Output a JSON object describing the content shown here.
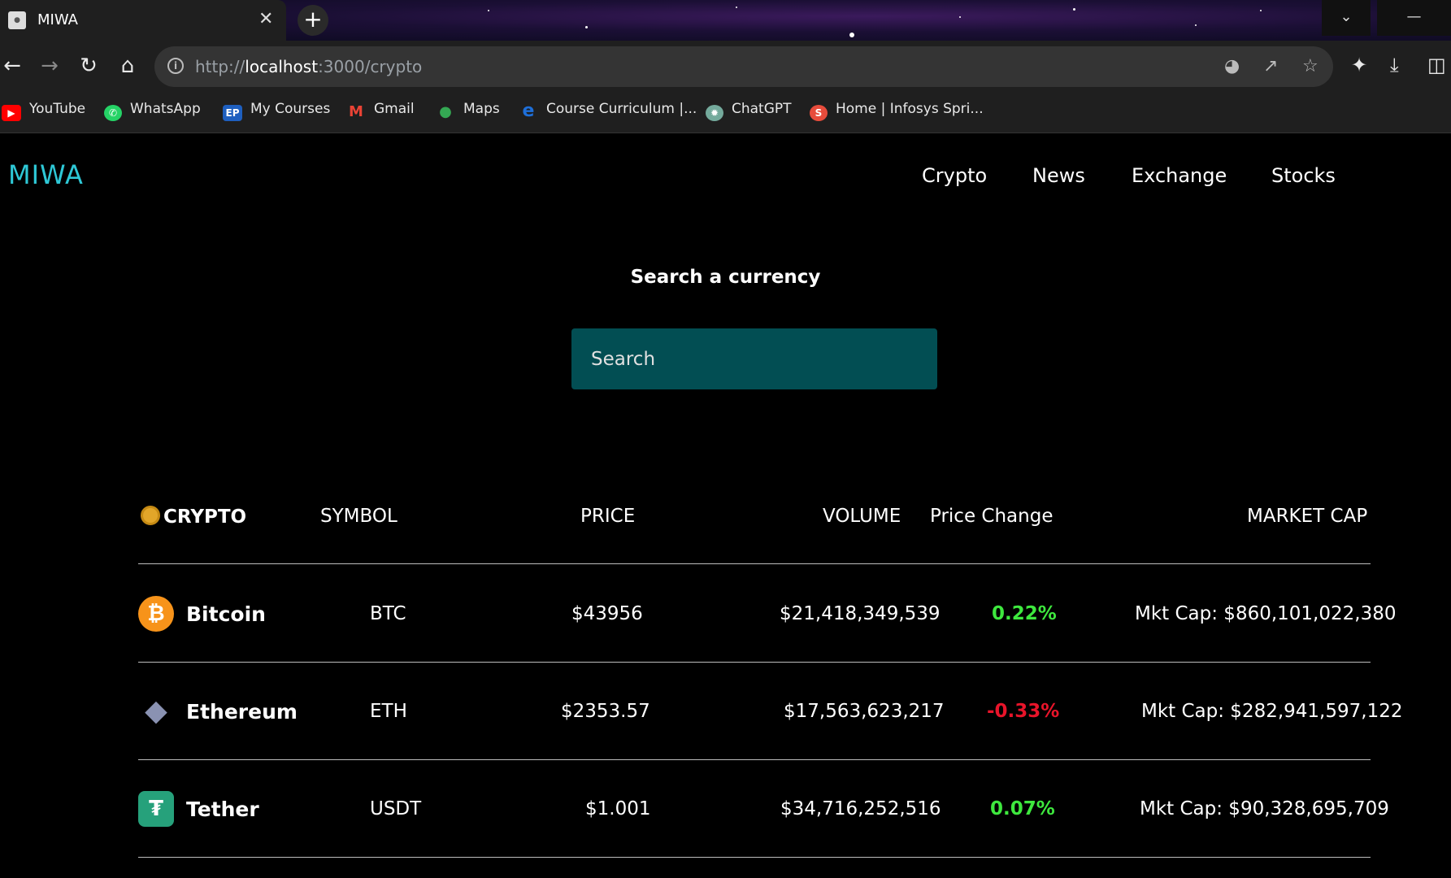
{
  "browser": {
    "tab_title": "MIWA",
    "tab_favicon": "favicon-icon",
    "url_scheme": "http://",
    "url_host": "localhost",
    "url_path": ":3000/crypto",
    "bookmarks": [
      {
        "label": "YouTube",
        "icon": "youtube-icon",
        "color": "#ff0000"
      },
      {
        "label": "WhatsApp",
        "icon": "whatsapp-icon",
        "color": "#25d366"
      },
      {
        "label": "My Courses",
        "icon": "ep-icon",
        "color": "#1e5fbf"
      },
      {
        "label": "Gmail",
        "icon": "gmail-icon",
        "color": "#ea4335"
      },
      {
        "label": "Maps",
        "icon": "maps-icon",
        "color": "#34a853"
      },
      {
        "label": "Course Curriculum |...",
        "icon": "e-icon",
        "color": "#1e6fd9"
      },
      {
        "label": "ChatGPT",
        "icon": "chatgpt-icon",
        "color": "#74aa9c"
      },
      {
        "label": "Home | Infosys Spri...",
        "icon": "infosys-icon",
        "color": "#e74c3c"
      }
    ]
  },
  "app": {
    "logo": "MIWA",
    "nav": [
      "Crypto",
      "News",
      "Exchange",
      "Stocks"
    ],
    "search_heading": "Search a currency",
    "search_placeholder": "Search"
  },
  "table": {
    "headers": {
      "crypto": "CRYPTO",
      "symbol": "SYMBOL",
      "price": "PRICE",
      "volume": "VOLUME",
      "price_change": "Price Change",
      "market_cap": "MARKET CAP"
    },
    "rows": [
      {
        "name": "Bitcoin",
        "symbol": "BTC",
        "price": "$43956",
        "volume": "$21,418,349,539",
        "change": "0.22%",
        "change_dir": "up",
        "market_cap": "Mkt Cap: $860,101,022,380",
        "icon": "bitcoin-icon",
        "icon_color": "#f7931a"
      },
      {
        "name": "Ethereum",
        "symbol": "ETH",
        "price": "$2353.57",
        "volume": "$17,563,623,217",
        "change": "-0.33%",
        "change_dir": "down",
        "market_cap": "Mkt Cap: $282,941,597,122",
        "icon": "ethereum-icon",
        "icon_color": "#8a92b2"
      },
      {
        "name": "Tether",
        "symbol": "USDT",
        "price": "$1.001",
        "volume": "$34,716,252,516",
        "change": "0.07%",
        "change_dir": "up",
        "market_cap": "Mkt Cap: $90,328,695,709",
        "icon": "tether-icon",
        "icon_color": "#26a17b"
      }
    ]
  },
  "colors": {
    "accent": "#2ec8d6",
    "search_bg": "#024e53",
    "positive": "#3ee83e",
    "negative": "#e8142a"
  }
}
